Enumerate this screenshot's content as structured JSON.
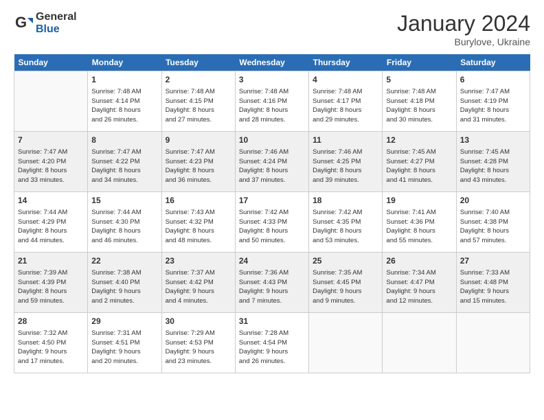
{
  "header": {
    "logo_general": "General",
    "logo_blue": "Blue",
    "title": "January 2024",
    "subtitle": "Burylove, Ukraine"
  },
  "days_of_week": [
    "Sunday",
    "Monday",
    "Tuesday",
    "Wednesday",
    "Thursday",
    "Friday",
    "Saturday"
  ],
  "weeks": [
    [
      {
        "day": "",
        "info": ""
      },
      {
        "day": "1",
        "info": "Sunrise: 7:48 AM\nSunset: 4:14 PM\nDaylight: 8 hours\nand 26 minutes."
      },
      {
        "day": "2",
        "info": "Sunrise: 7:48 AM\nSunset: 4:15 PM\nDaylight: 8 hours\nand 27 minutes."
      },
      {
        "day": "3",
        "info": "Sunrise: 7:48 AM\nSunset: 4:16 PM\nDaylight: 8 hours\nand 28 minutes."
      },
      {
        "day": "4",
        "info": "Sunrise: 7:48 AM\nSunset: 4:17 PM\nDaylight: 8 hours\nand 29 minutes."
      },
      {
        "day": "5",
        "info": "Sunrise: 7:48 AM\nSunset: 4:18 PM\nDaylight: 8 hours\nand 30 minutes."
      },
      {
        "day": "6",
        "info": "Sunrise: 7:47 AM\nSunset: 4:19 PM\nDaylight: 8 hours\nand 31 minutes."
      }
    ],
    [
      {
        "day": "7",
        "info": "Sunrise: 7:47 AM\nSunset: 4:20 PM\nDaylight: 8 hours\nand 33 minutes."
      },
      {
        "day": "8",
        "info": "Sunrise: 7:47 AM\nSunset: 4:22 PM\nDaylight: 8 hours\nand 34 minutes."
      },
      {
        "day": "9",
        "info": "Sunrise: 7:47 AM\nSunset: 4:23 PM\nDaylight: 8 hours\nand 36 minutes."
      },
      {
        "day": "10",
        "info": "Sunrise: 7:46 AM\nSunset: 4:24 PM\nDaylight: 8 hours\nand 37 minutes."
      },
      {
        "day": "11",
        "info": "Sunrise: 7:46 AM\nSunset: 4:25 PM\nDaylight: 8 hours\nand 39 minutes."
      },
      {
        "day": "12",
        "info": "Sunrise: 7:45 AM\nSunset: 4:27 PM\nDaylight: 8 hours\nand 41 minutes."
      },
      {
        "day": "13",
        "info": "Sunrise: 7:45 AM\nSunset: 4:28 PM\nDaylight: 8 hours\nand 43 minutes."
      }
    ],
    [
      {
        "day": "14",
        "info": "Sunrise: 7:44 AM\nSunset: 4:29 PM\nDaylight: 8 hours\nand 44 minutes."
      },
      {
        "day": "15",
        "info": "Sunrise: 7:44 AM\nSunset: 4:30 PM\nDaylight: 8 hours\nand 46 minutes."
      },
      {
        "day": "16",
        "info": "Sunrise: 7:43 AM\nSunset: 4:32 PM\nDaylight: 8 hours\nand 48 minutes."
      },
      {
        "day": "17",
        "info": "Sunrise: 7:42 AM\nSunset: 4:33 PM\nDaylight: 8 hours\nand 50 minutes."
      },
      {
        "day": "18",
        "info": "Sunrise: 7:42 AM\nSunset: 4:35 PM\nDaylight: 8 hours\nand 53 minutes."
      },
      {
        "day": "19",
        "info": "Sunrise: 7:41 AM\nSunset: 4:36 PM\nDaylight: 8 hours\nand 55 minutes."
      },
      {
        "day": "20",
        "info": "Sunrise: 7:40 AM\nSunset: 4:38 PM\nDaylight: 8 hours\nand 57 minutes."
      }
    ],
    [
      {
        "day": "21",
        "info": "Sunrise: 7:39 AM\nSunset: 4:39 PM\nDaylight: 8 hours\nand 59 minutes."
      },
      {
        "day": "22",
        "info": "Sunrise: 7:38 AM\nSunset: 4:40 PM\nDaylight: 9 hours\nand 2 minutes."
      },
      {
        "day": "23",
        "info": "Sunrise: 7:37 AM\nSunset: 4:42 PM\nDaylight: 9 hours\nand 4 minutes."
      },
      {
        "day": "24",
        "info": "Sunrise: 7:36 AM\nSunset: 4:43 PM\nDaylight: 9 hours\nand 7 minutes."
      },
      {
        "day": "25",
        "info": "Sunrise: 7:35 AM\nSunset: 4:45 PM\nDaylight: 9 hours\nand 9 minutes."
      },
      {
        "day": "26",
        "info": "Sunrise: 7:34 AM\nSunset: 4:47 PM\nDaylight: 9 hours\nand 12 minutes."
      },
      {
        "day": "27",
        "info": "Sunrise: 7:33 AM\nSunset: 4:48 PM\nDaylight: 9 hours\nand 15 minutes."
      }
    ],
    [
      {
        "day": "28",
        "info": "Sunrise: 7:32 AM\nSunset: 4:50 PM\nDaylight: 9 hours\nand 17 minutes."
      },
      {
        "day": "29",
        "info": "Sunrise: 7:31 AM\nSunset: 4:51 PM\nDaylight: 9 hours\nand 20 minutes."
      },
      {
        "day": "30",
        "info": "Sunrise: 7:29 AM\nSunset: 4:53 PM\nDaylight: 9 hours\nand 23 minutes."
      },
      {
        "day": "31",
        "info": "Sunrise: 7:28 AM\nSunset: 4:54 PM\nDaylight: 9 hours\nand 26 minutes."
      },
      {
        "day": "",
        "info": ""
      },
      {
        "day": "",
        "info": ""
      },
      {
        "day": "",
        "info": ""
      }
    ]
  ]
}
